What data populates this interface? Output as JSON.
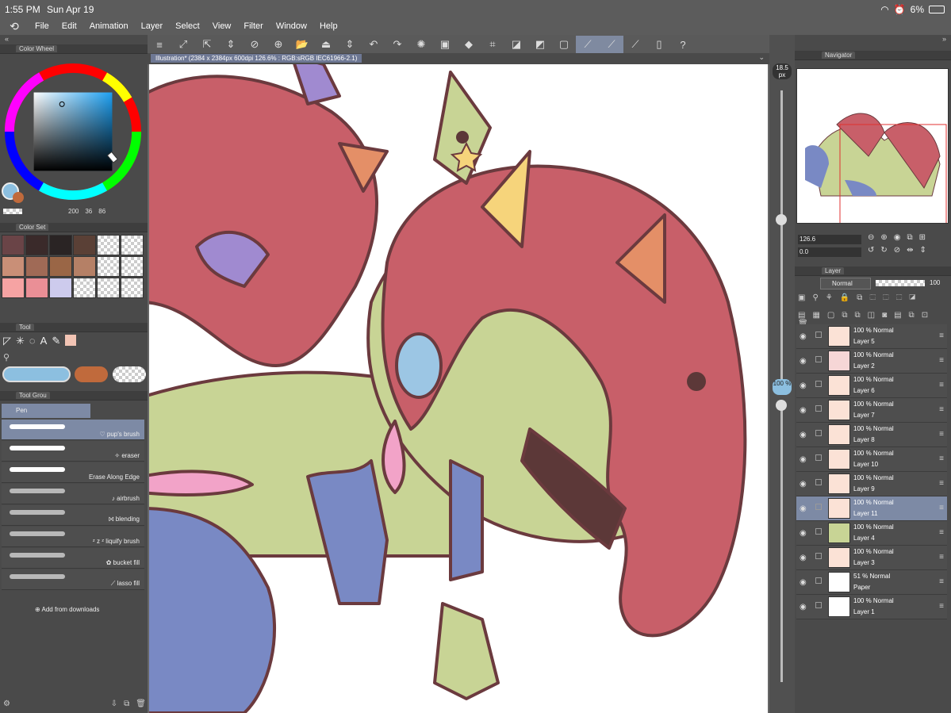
{
  "status": {
    "time": "1:55 PM",
    "date": "Sun Apr 19",
    "battery": "6%"
  },
  "menu": [
    "File",
    "Edit",
    "Animation",
    "Layer",
    "Select",
    "View",
    "Filter",
    "Window",
    "Help"
  ],
  "panels": {
    "color_wheel": "Color Wheel",
    "color_set": "Color Set",
    "tool": "Tool",
    "tool_group": "Tool Grou",
    "navigator": "Navigator",
    "layer": "Layer"
  },
  "color_values": {
    "v1": "200",
    "v2": "36",
    "v3": "86"
  },
  "swatches": [
    "#6a4447",
    "#3a2a2a",
    "#2a2424",
    "#5a4036",
    "checker",
    "checker",
    "#c98f77",
    "#a06a56",
    "#9a6646",
    "#b58066",
    "checker",
    "checker",
    "#f6a3a3",
    "#ea8f96",
    "#cdcbed",
    "checker",
    "checker",
    "checker"
  ],
  "tool_group_active": "Pen",
  "brushes": [
    {
      "label": "♡ pup's brush",
      "selected": true
    },
    {
      "label": "✧ eraser",
      "selected": false
    },
    {
      "label": "Erase Along Edge",
      "selected": false
    },
    {
      "label": "♪ airbrush",
      "selected": false
    },
    {
      "label": "⨝ blending",
      "selected": false
    },
    {
      "label": "ᶻ z ᶻ liquify brush",
      "selected": false
    },
    {
      "label": "✿ bucket fill",
      "selected": false
    },
    {
      "label": "⟋ lasso fill",
      "selected": false
    }
  ],
  "add_downloads": "Add from downloads",
  "document_title": "Illustration* (2384 x 2384px 600dpi 126.6% : RGB:sRGB IEC61966-2.1)",
  "brush_size": "18.5 px",
  "opacity_slider": "100 %",
  "nav": {
    "zoom": "126.6",
    "rotate": "0.0"
  },
  "blend_mode": "Normal",
  "layer_opacity": "100",
  "layers": [
    {
      "opacity": "100 %  Normal",
      "name": "Layer 5",
      "selected": false
    },
    {
      "opacity": "100 %  Normal",
      "name": "Layer 2",
      "selected": false
    },
    {
      "opacity": "100 %  Normal",
      "name": "Layer 6",
      "selected": false
    },
    {
      "opacity": "100 %  Normal",
      "name": "Layer 7",
      "selected": false
    },
    {
      "opacity": "100 %  Normal",
      "name": "Layer 8",
      "selected": false
    },
    {
      "opacity": "100 %  Normal",
      "name": "Layer 10",
      "selected": false
    },
    {
      "opacity": "100 %  Normal",
      "name": "Layer 9",
      "selected": false
    },
    {
      "opacity": "100 %  Normal",
      "name": "Layer 11",
      "selected": true
    },
    {
      "opacity": "100 %  Normal",
      "name": "Layer 4",
      "selected": false
    },
    {
      "opacity": "100 %  Normal",
      "name": "Layer 3",
      "selected": false
    },
    {
      "opacity": "51 %  Normal",
      "name": "Paper",
      "selected": false
    },
    {
      "opacity": "100 %  Normal",
      "name": "Layer 1",
      "selected": false
    }
  ]
}
